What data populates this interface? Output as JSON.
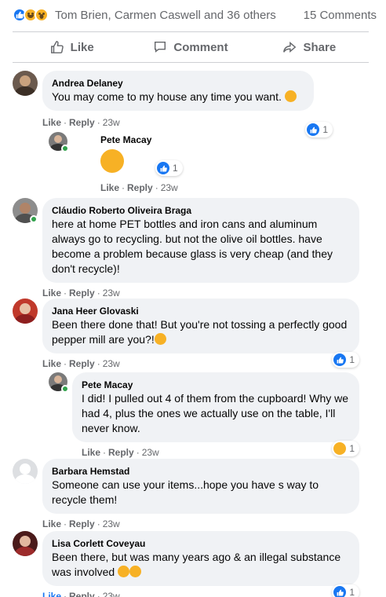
{
  "reactions_summary": {
    "names": "Tom Brien, Carmen Caswell and 36 others",
    "comments": "15 Comments"
  },
  "actions": {
    "like": "Like",
    "comment": "Comment",
    "share": "Share"
  },
  "comments": [
    {
      "author": "Andrea Delaney",
      "text": "You may come to my house any time you want.",
      "like": "Like",
      "reply": "Reply",
      "time": "23w",
      "reaction_count": "1"
    },
    {
      "author": "Pete Macay",
      "like": "Like",
      "reply": "Reply",
      "time": "23w",
      "reaction_count": "1"
    },
    {
      "author": "Cláudio Roberto Oliveira Braga",
      "text": "here at home PET bottles and iron cans and aluminum always go to recycling. but not the olive oil bottles. have become a problem because glass is very cheap (and they don't recycle)!",
      "like": "Like",
      "reply": "Reply",
      "time": "23w"
    },
    {
      "author": "Jana Heer Glovaski",
      "text": "Been there done that! But you're not tossing a perfectly good pepper mill are you?!",
      "like": "Like",
      "reply": "Reply",
      "time": "23w",
      "reaction_count": "1"
    },
    {
      "author": "Pete Macay",
      "text": "I did! I pulled out 4 of them from the cupboard! Why we had 4, plus the ones we actually use on the table, I'll never know.",
      "like": "Like",
      "reply": "Reply",
      "time": "23w",
      "reaction_count": "1"
    },
    {
      "author": "Barbara Hemstad",
      "text": "Someone can use your items...hope you have s way to recycle them!",
      "like": "Like",
      "reply": "Reply",
      "time": "23w"
    },
    {
      "author": "Lisa Corlett Coveyau",
      "text": "Been there, but was many years ago & an illegal substance was involved",
      "like": "Like",
      "reply": "Reply",
      "time": "23w",
      "reaction_count": "1"
    }
  ],
  "colors": {
    "accent": "#1877f2",
    "bubble": "#f0f2f5",
    "muted": "#65676b"
  }
}
